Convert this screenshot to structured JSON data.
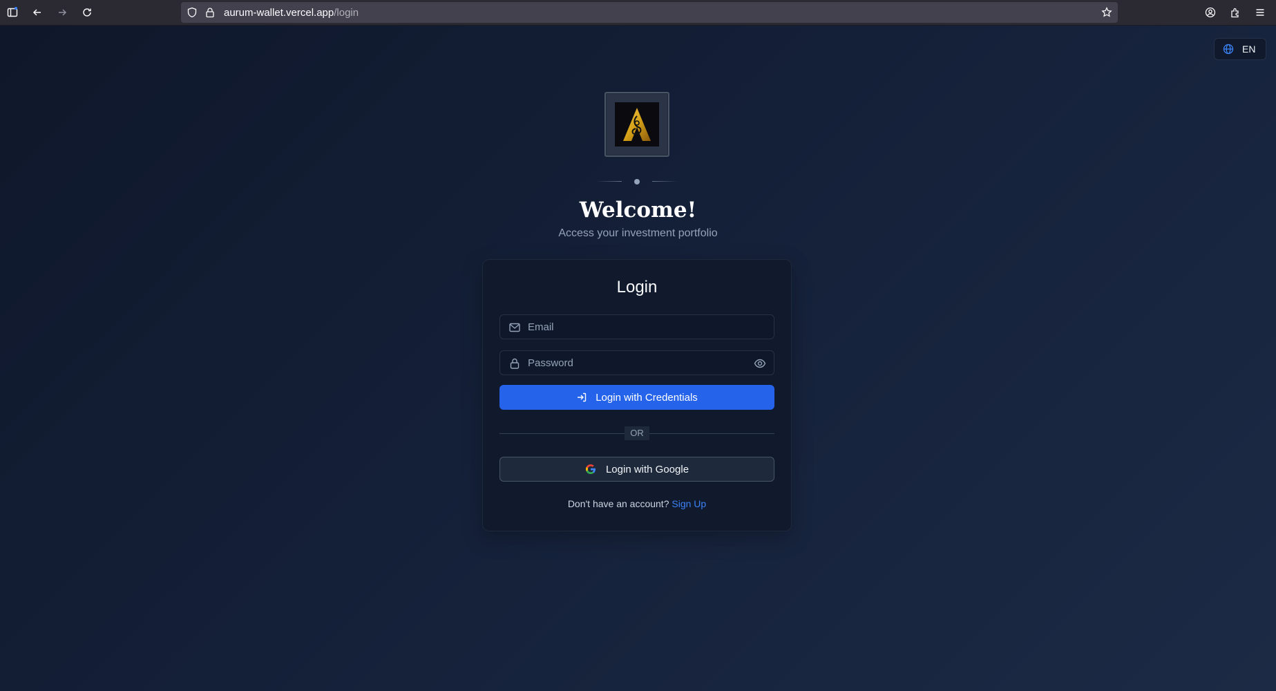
{
  "browser": {
    "url_host": "aurum-wallet.vercel.app",
    "url_path": "/login"
  },
  "language": {
    "code": "EN",
    "icon": "globe-icon"
  },
  "hero": {
    "title": "Welcome!",
    "subtitle": "Access your investment portfolio"
  },
  "login": {
    "title": "Login",
    "email_placeholder": "Email",
    "password_placeholder": "Password",
    "credentials_button": "Login with Credentials",
    "or_label": "OR",
    "google_button": "Login with Google",
    "no_account_text": "Don't have an account?",
    "signup_link": "Sign Up"
  },
  "colors": {
    "primary": "#2563eb",
    "background": "#0f172a",
    "card": "#111a2c",
    "link": "#3b82f6",
    "logo_gold": "#d4a017"
  }
}
